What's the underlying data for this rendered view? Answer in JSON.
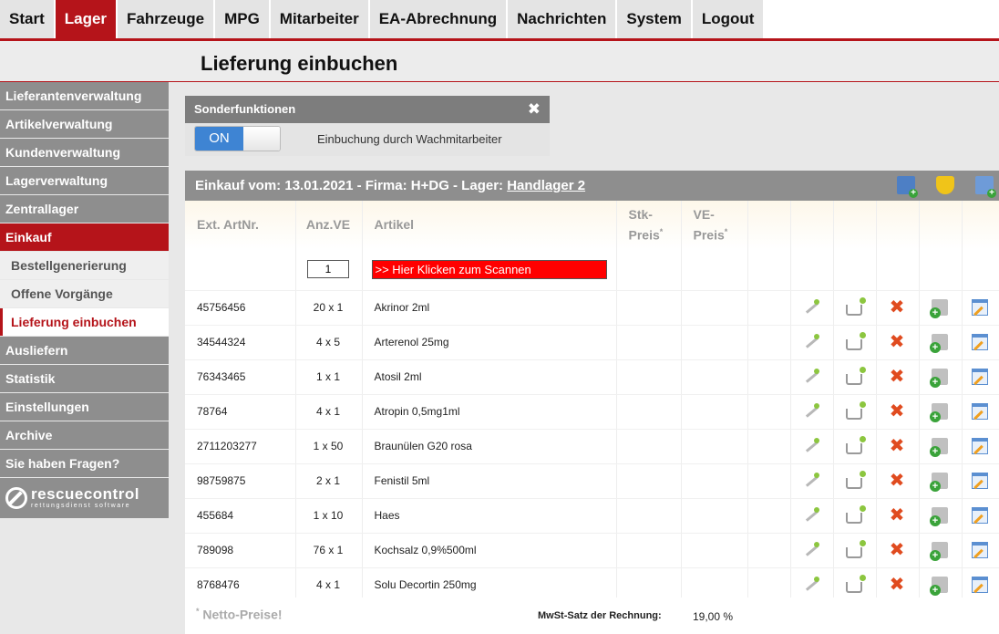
{
  "nav": {
    "tabs": [
      "Start",
      "Lager",
      "Fahrzeuge",
      "MPG",
      "Mitarbeiter",
      "EA-Abrechnung",
      "Nachrichten",
      "System",
      "Logout"
    ],
    "active": "Lager"
  },
  "page": {
    "title": "Lieferung einbuchen"
  },
  "sidebar": {
    "items": [
      {
        "label": "Lieferantenverwaltung"
      },
      {
        "label": "Artikelverwaltung"
      },
      {
        "label": "Kundenverwaltung"
      },
      {
        "label": "Lagerverwaltung"
      },
      {
        "label": "Zentrallager"
      },
      {
        "label": "Einkauf"
      },
      {
        "label": "Bestellgenerierung"
      },
      {
        "label": "Offene Vorgänge"
      },
      {
        "label": "Lieferung einbuchen"
      },
      {
        "label": "Ausliefern"
      },
      {
        "label": "Statistik"
      },
      {
        "label": "Einstellungen"
      },
      {
        "label": "Archive"
      },
      {
        "label": "Sie haben Fragen?"
      }
    ],
    "logo": {
      "line1": "rescuecontrol",
      "line2": "rettungsdienst software"
    }
  },
  "sonder": {
    "title": "Sonderfunktionen",
    "toggle_label": "ON",
    "description": "Einbuchung durch Wachmitarbeiter"
  },
  "panel": {
    "title_prefix": "Einkauf vom: 13.01.2021 - Firma: H+DG - Lager: ",
    "lager_link": "Handlager 2",
    "columns": {
      "ext": "Ext. ArtNr.",
      "anz": "Anz.VE",
      "artikel": "Artikel",
      "stk1": "Stk-",
      "stk2": "Preis",
      "ve1": "VE-",
      "ve2": "Preis",
      "star": "*"
    },
    "scan": {
      "qty": "1",
      "button": ">> Hier Klicken zum Scannen"
    },
    "rows": [
      {
        "ext": "45756456",
        "anz": "20 x 1",
        "artikel": "Akrinor 2ml"
      },
      {
        "ext": "34544324",
        "anz": "4 x 5",
        "artikel": "Arterenol 25mg"
      },
      {
        "ext": "76343465",
        "anz": "1 x 1",
        "artikel": "Atosil 2ml"
      },
      {
        "ext": "78764",
        "anz": "4 x 1",
        "artikel": "Atropin 0,5mg1ml"
      },
      {
        "ext": "2711203277",
        "anz": "1 x 50",
        "artikel": "Braunülen G20 rosa"
      },
      {
        "ext": "98759875",
        "anz": "2 x 1",
        "artikel": "Fenistil 5ml"
      },
      {
        "ext": "455684",
        "anz": "1 x 10",
        "artikel": "Haes"
      },
      {
        "ext": "789098",
        "anz": "76 x 1",
        "artikel": "Kochsalz 0,9%500ml"
      },
      {
        "ext": "8768476",
        "anz": "4 x 1",
        "artikel": "Solu Decortin 250mg"
      }
    ],
    "footer": {
      "star": "*",
      "note": " Netto-Preise!",
      "mwst_label": "MwSt-Satz der Rechnung:",
      "mwst_value": "19,00 %"
    }
  }
}
